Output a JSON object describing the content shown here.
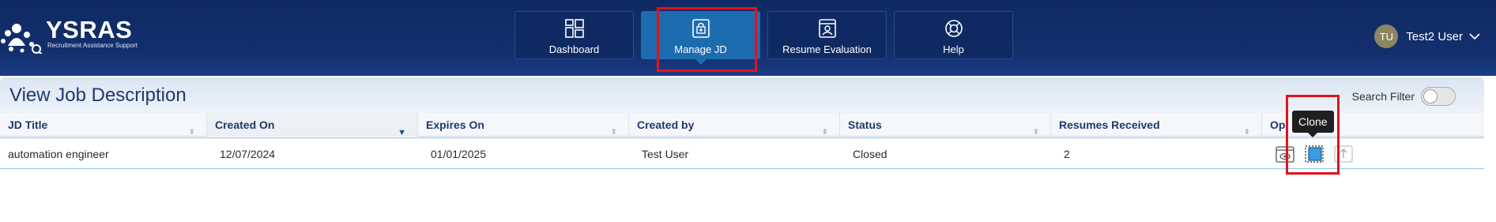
{
  "brand": {
    "name": "YSRAS",
    "tagline": "Recruitment Assistance Support"
  },
  "nav": [
    {
      "label": "Dashboard",
      "icon": "dashboard-icon"
    },
    {
      "label": "Manage JD",
      "icon": "manage-jd-icon",
      "active": true
    },
    {
      "label": "Resume Evaluation",
      "icon": "resume-icon"
    },
    {
      "label": "Help",
      "icon": "help-icon"
    }
  ],
  "user": {
    "initials": "TU",
    "name": "Test2 User"
  },
  "page": {
    "title": "View Job Description",
    "filter_label": "Search Filter",
    "filter_on": false
  },
  "table": {
    "columns": [
      "JD Title",
      "Created On",
      "Expires On",
      "Created by",
      "Status",
      "Resumes Received",
      "Op"
    ],
    "rows": [
      {
        "title": "automation engineer",
        "created_on": "12/07/2024",
        "expires_on": "01/01/2025",
        "created_by": "Test User",
        "status": "Closed",
        "resumes": "2"
      }
    ]
  },
  "tooltip": "Clone",
  "colors": {
    "header": "#0f2a63",
    "active_nav": "#1d6cb0",
    "highlight": "#e3121b"
  }
}
